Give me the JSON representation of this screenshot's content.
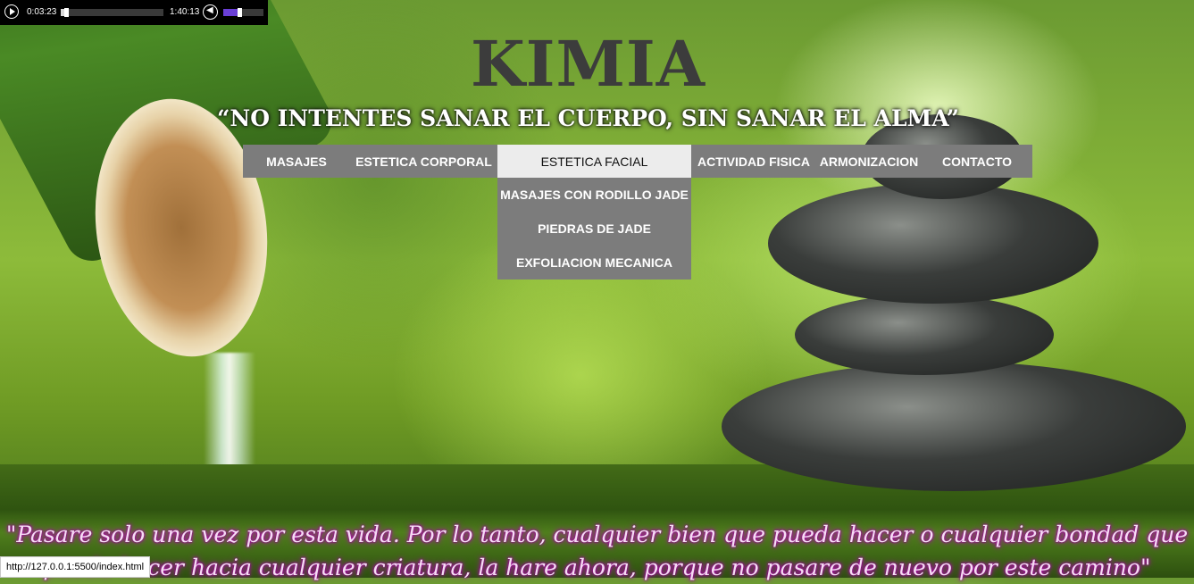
{
  "player": {
    "current_time": "0:03:23",
    "total_time": "1:40:13",
    "progress": 0.034,
    "volume": 0.35,
    "icons": {
      "play": "play-icon",
      "volume": "volume-icon"
    }
  },
  "header": {
    "logo": "KIMIA",
    "quote": "“NO INTENTES SANAR EL CUERPO, SIN SANAR EL ALMA”"
  },
  "nav": {
    "items": [
      {
        "label": "MASAJES"
      },
      {
        "label": "ESTETICA CORPORAL"
      },
      {
        "label": "ESTETICA FACIAL"
      },
      {
        "label": "ACTIVIDAD FISICA"
      },
      {
        "label": "ARMONIZACION"
      },
      {
        "label": "CONTACTO"
      }
    ],
    "submenu": [
      {
        "label": "MASAJES CON RODILLO JADE"
      },
      {
        "label": "PIEDRAS DE JADE"
      },
      {
        "label": "EXFOLIACION MECANICA"
      }
    ]
  },
  "footer_quote": {
    "line1": "\"Pasare solo una vez por esta vida. Por lo tanto, cualquier bien que pueda hacer o cualquier bondad que",
    "line2": "pueda hacer hacia cualquier criatura, la hare ahora, porque no pasare de nuevo por este camino\""
  },
  "status_bar": {
    "url": "http://127.0.0.1:5500/index.html"
  },
  "colors": {
    "nav_bg": "#7c7c7c",
    "nav_active_bg": "#ececec",
    "logo": "#3c3c3c",
    "quote_glow": "#c000c0"
  }
}
